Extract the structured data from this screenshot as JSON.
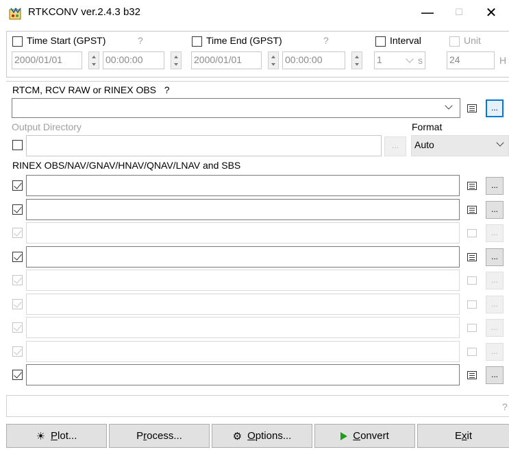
{
  "window": {
    "title": "RTKCONV ver.2.4.3 b32",
    "minimize": "—",
    "maximize": "☐",
    "close": "✕"
  },
  "time": {
    "start_label": "Time Start (GPST)",
    "start_help": "?",
    "start_date": "2000/01/01",
    "start_time": "00:00:00",
    "end_label": "Time End (GPST)",
    "end_help": "?",
    "end_date": "2000/01/01",
    "end_time": "00:00:00",
    "interval_label": "Interval",
    "interval_value": "1",
    "interval_unit": "s",
    "unit_label": "Unit",
    "unit_value": "24",
    "unit_suffix": "H"
  },
  "input": {
    "label": "RTCM, RCV RAW or RINEX OBS",
    "help": "?",
    "value": "",
    "browse": "..."
  },
  "output": {
    "label": "Output Directory",
    "browse": "...",
    "format_label": "Format",
    "format_value": "Auto"
  },
  "rinex": {
    "label": "RINEX OBS/NAV/GNAV/HNAV/QNAV/LNAV and SBS",
    "browse": "...",
    "rows": [
      {
        "enabled": true
      },
      {
        "enabled": true
      },
      {
        "enabled": false
      },
      {
        "enabled": true
      },
      {
        "enabled": false
      },
      {
        "enabled": false
      },
      {
        "enabled": false
      },
      {
        "enabled": false
      },
      {
        "enabled": true
      }
    ]
  },
  "status": {
    "message": "",
    "help": "?"
  },
  "buttons": {
    "plot_pre": "",
    "plot_u": "P",
    "plot_post": "lot...",
    "process_pre": "P",
    "process_u": "r",
    "process_post": "ocess...",
    "options_pre": "",
    "options_u": "O",
    "options_post": "ptions...",
    "convert_pre": "",
    "convert_u": "C",
    "convert_post": "onvert",
    "exit_pre": "E",
    "exit_u": "x",
    "exit_post": "it"
  },
  "colors": {
    "accent": "#0078d7",
    "convert_icon": "#1aa01a"
  }
}
